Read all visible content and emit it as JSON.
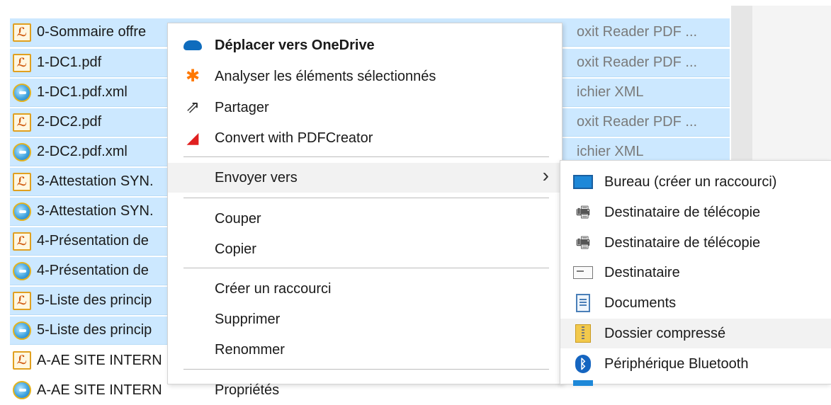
{
  "files": [
    {
      "name": "0-Sommaire offre",
      "type": "oxit Reader PDF ...",
      "icon": "pdf-icon",
      "selected": true
    },
    {
      "name": "1-DC1.pdf",
      "type": "oxit Reader PDF ...",
      "icon": "pdf-icon",
      "selected": true
    },
    {
      "name": "1-DC1.pdf.xml",
      "type": "ichier XML",
      "icon": "xml-ie-icon",
      "selected": true
    },
    {
      "name": "2-DC2.pdf",
      "type": "oxit Reader PDF ...",
      "icon": "pdf-icon",
      "selected": true
    },
    {
      "name": "2-DC2.pdf.xml",
      "type": "ichier XML",
      "icon": "xml-ie-icon",
      "selected": true
    },
    {
      "name": "3-Attestation SYN.",
      "type": "",
      "icon": "pdf-icon",
      "selected": true
    },
    {
      "name": "3-Attestation SYN.",
      "type": "",
      "icon": "xml-ie-icon",
      "selected": true
    },
    {
      "name": "4-Présentation de",
      "type": "",
      "icon": "pdf-icon",
      "selected": true
    },
    {
      "name": "4-Présentation de",
      "type": "",
      "icon": "xml-ie-icon",
      "selected": true
    },
    {
      "name": "5-Liste des princip",
      "type": "",
      "icon": "pdf-icon",
      "selected": true
    },
    {
      "name": "5-Liste des princip",
      "type": "",
      "icon": "xml-ie-icon",
      "selected": true
    },
    {
      "name": "A-AE SITE INTERN",
      "type": "",
      "icon": "pdf-icon",
      "selected": false
    },
    {
      "name": "A-AE SITE INTERN",
      "type": "",
      "icon": "xml-ie-icon",
      "selected": false
    }
  ],
  "context_menu": {
    "onedrive": "Déplacer vers OneDrive",
    "analyze": "Analyser les éléments sélectionnés",
    "share": "Partager",
    "pdfcreator": "Convert with PDFCreator",
    "send_to": "Envoyer vers",
    "cut": "Couper",
    "copy": "Copier",
    "create_shortcut": "Créer un raccourci",
    "delete": "Supprimer",
    "rename": "Renommer",
    "properties": "Propriétés"
  },
  "submenu": {
    "desktop": "Bureau (créer un raccourci)",
    "fax1": "Destinataire de télécopie",
    "fax2": "Destinataire de télécopie",
    "mail": "Destinataire",
    "documents": "Documents",
    "zip": "Dossier compressé",
    "bluetooth": "Périphérique Bluetooth"
  },
  "colors": {
    "selection": "#cce8ff",
    "hover": "#f2f2f2",
    "onedrive": "#0f6cbd",
    "pdfcreator": "#e02020"
  }
}
